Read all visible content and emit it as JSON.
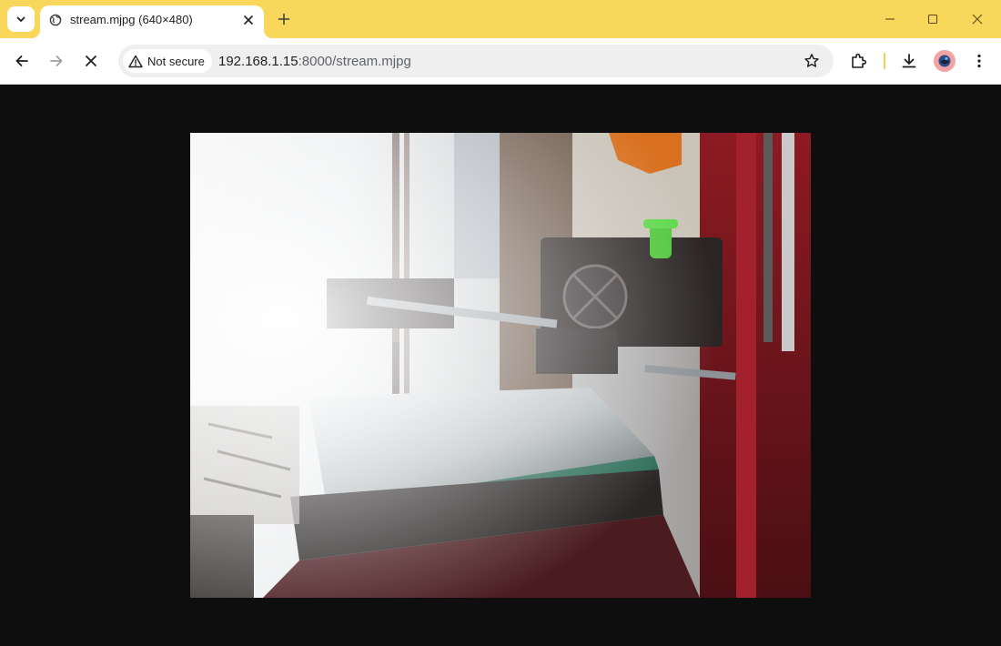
{
  "tab": {
    "title": "stream.mjpg (640×480)",
    "favicon": "globe-icon"
  },
  "toolbar": {
    "security_chip": "Not secure",
    "url_host": "192.168.1.15",
    "url_rest": ":8000/stream.mjpg"
  },
  "icons": {
    "tab_search": "chevron-down-icon",
    "close_tab": "close-icon",
    "new_tab": "plus-icon",
    "minimize": "minimize-icon",
    "maximize": "maximize-icon",
    "close_window": "close-icon",
    "back": "arrow-left-icon",
    "forward": "arrow-right-icon",
    "stop": "stop-loading-icon",
    "warning": "warning-icon",
    "bookmark": "star-icon",
    "extensions": "puzzle-icon",
    "downloads": "download-icon",
    "profile": "avatar",
    "menu": "kebab-menu-icon"
  },
  "colors": {
    "titlebar": "#f9d75b",
    "page_background": "#0e0e0e"
  },
  "content": {
    "image": "MJPEG camera stream of a 3D printer with red frame and glass bed"
  }
}
